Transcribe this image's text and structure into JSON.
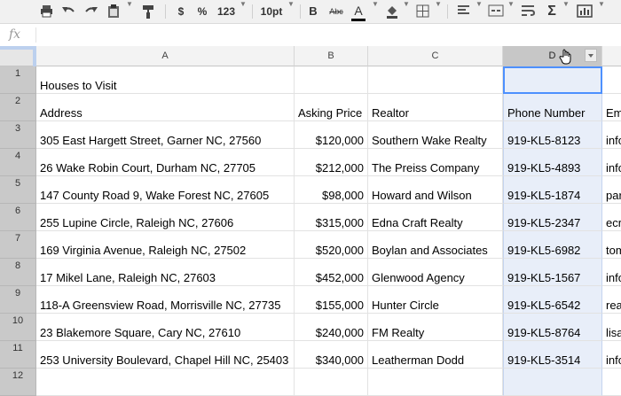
{
  "toolbar": {
    "currency": "$",
    "percent": "%",
    "number_format": "123",
    "font_size": "10pt",
    "bold": "B",
    "strike": "Abc",
    "text_color": "A",
    "sigma": "Σ"
  },
  "formula_bar": {
    "fx": "fx",
    "value": ""
  },
  "columns": [
    {
      "id": "A",
      "label": "A"
    },
    {
      "id": "B",
      "label": "B"
    },
    {
      "id": "C",
      "label": "C"
    },
    {
      "id": "D",
      "label": "D"
    },
    {
      "id": "E",
      "label": ""
    }
  ],
  "rows": [
    "1",
    "2",
    "3",
    "4",
    "5",
    "6",
    "7",
    "8",
    "9",
    "10",
    "11",
    "12"
  ],
  "sheet": {
    "title": "Houses to Visit",
    "headers": [
      "Address",
      "Asking Price",
      "Realtor",
      "Phone Number",
      "Em"
    ],
    "data": [
      [
        "305 East Hargett Street, Garner NC, 27560",
        "$120,000",
        "Southern Wake Realty",
        "919-KL5-8123",
        "info"
      ],
      [
        "26 Wake Robin Court, Durham NC, 27705",
        "$212,000",
        "The Preiss Company",
        "919-KL5-4893",
        "info"
      ],
      [
        "147 County Road 9, Wake Forest NC, 27605",
        "$98,000",
        "Howard and Wilson",
        "919-KL5-1874",
        "par"
      ],
      [
        "255 Lupine Circle, Raleigh NC, 27606",
        "$315,000",
        "Edna Craft Realty",
        "919-KL5-2347",
        "ecr"
      ],
      [
        "169 Virginia Avenue, Raleigh NC, 27502",
        "$520,000",
        "Boylan and Associates",
        "919-KL5-6982",
        "tom"
      ],
      [
        "17 Mikel Lane, Raleigh NC, 27603",
        "$452,000",
        "Glenwood Agency",
        "919-KL5-1567",
        "info"
      ],
      [
        "118-A Greensview Road, Morrisville NC, 27735",
        "$155,000",
        "Hunter Circle",
        "919-KL5-6542",
        "rea"
      ],
      [
        "23 Blakemore Square, Cary NC, 27610",
        "$240,000",
        "FM Realty",
        "919-KL5-8764",
        "lisa"
      ],
      [
        "253 University Boulevard, Chapel Hill NC, 25403",
        "$340,000",
        "Leatherman Dodd",
        "919-KL5-3514",
        "info"
      ]
    ]
  },
  "colors": {
    "selection": "#e8eef9",
    "selection_header": "#c7c7c7",
    "active_border": "#4d90fe"
  }
}
